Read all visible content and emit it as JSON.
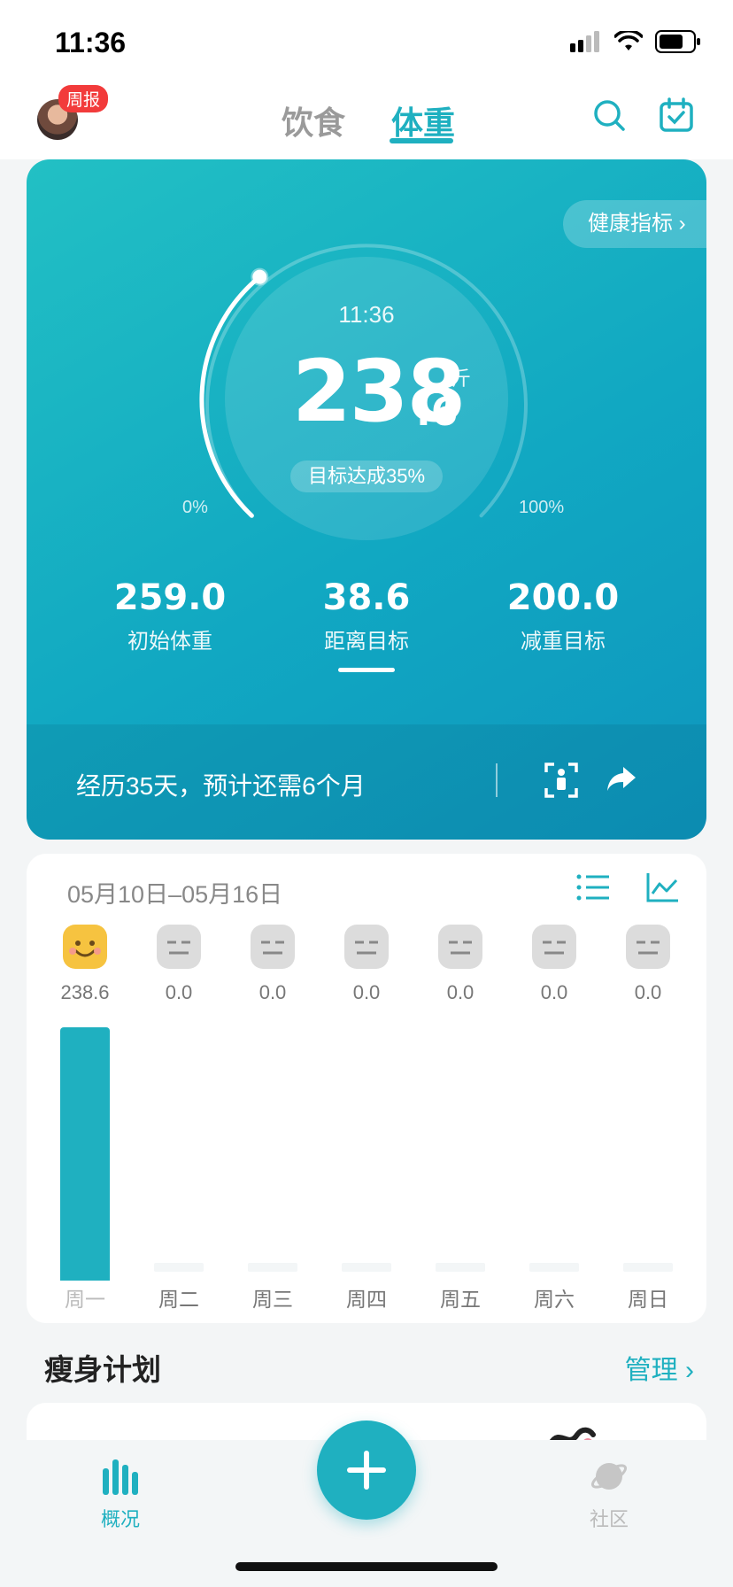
{
  "status": {
    "time": "11:36"
  },
  "header": {
    "weekly_badge": "周报",
    "tabs": [
      {
        "label": "饮食",
        "active": false
      },
      {
        "label": "体重",
        "active": true
      }
    ]
  },
  "hero": {
    "health_link": "健康指标 ›",
    "time": "11:36",
    "weight_int": "238",
    "weight_decimal": ".6",
    "unit": "斤",
    "progress_label": "目标达成35%",
    "progress_fraction": 0.35,
    "gauge_min": "0%",
    "gauge_max": "100%",
    "stats": [
      {
        "value": "259.0",
        "label": "初始体重"
      },
      {
        "value": "38.6",
        "label": "距离目标"
      },
      {
        "value": "200.0",
        "label": "减重目标"
      }
    ],
    "footer_text": "经历35天，预计还需6个月"
  },
  "week": {
    "date_range": "05月10日–05月16日",
    "days": [
      {
        "value": "238.6",
        "label": "周一",
        "mood": "happy"
      },
      {
        "value": "0.0",
        "label": "周二",
        "mood": "neutral"
      },
      {
        "value": "0.0",
        "label": "周三",
        "mood": "neutral"
      },
      {
        "value": "0.0",
        "label": "周四",
        "mood": "neutral"
      },
      {
        "value": "0.0",
        "label": "周五",
        "mood": "neutral"
      },
      {
        "value": "0.0",
        "label": "周六",
        "mood": "neutral"
      },
      {
        "value": "0.0",
        "label": "周日",
        "mood": "neutral"
      }
    ]
  },
  "plan": {
    "title": "瘦身计划",
    "manage": "管理 ›"
  },
  "tabbar": {
    "items": [
      {
        "label": "概况",
        "active": true
      },
      {
        "label": "社区",
        "active": false
      }
    ]
  },
  "colors": {
    "accent": "#1fb0c0",
    "badge": "#f23b3b"
  }
}
